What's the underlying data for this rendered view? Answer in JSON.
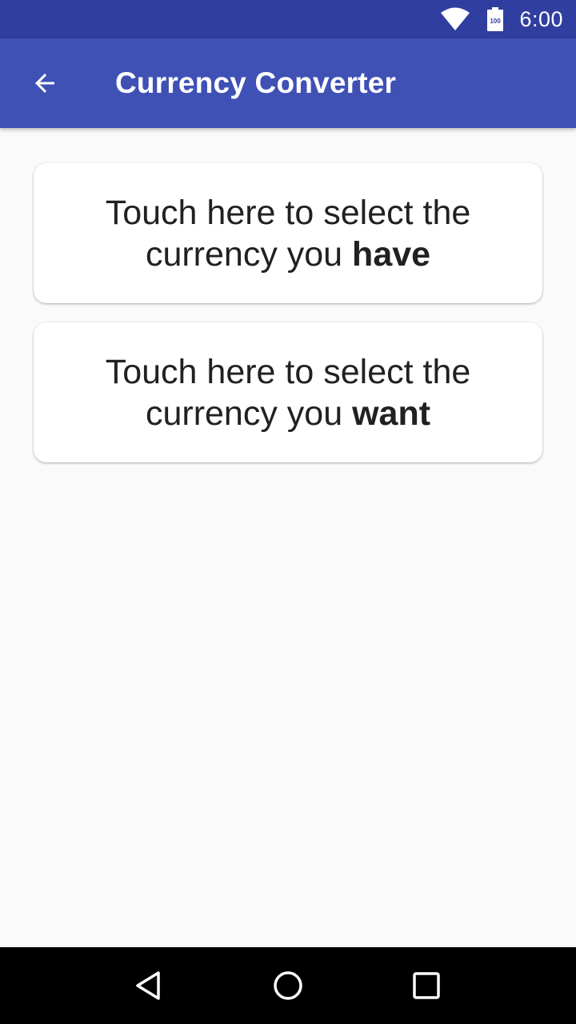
{
  "status_bar": {
    "time": "6:00",
    "battery_level": "100",
    "icons": [
      "wifi-icon",
      "battery-icon"
    ]
  },
  "app_bar": {
    "title": "Currency Converter",
    "back_icon": "arrow-back-icon",
    "color": "#3F51B5",
    "status_color": "#303F9F"
  },
  "cards": {
    "have": {
      "prefix": "Touch here to select the currency you ",
      "emphasis": "have"
    },
    "want": {
      "prefix": "Touch here to select the currency you ",
      "emphasis": "want"
    }
  },
  "nav_bar": {
    "icons": [
      "back-triangle-icon",
      "home-circle-icon",
      "recents-square-icon"
    ]
  }
}
